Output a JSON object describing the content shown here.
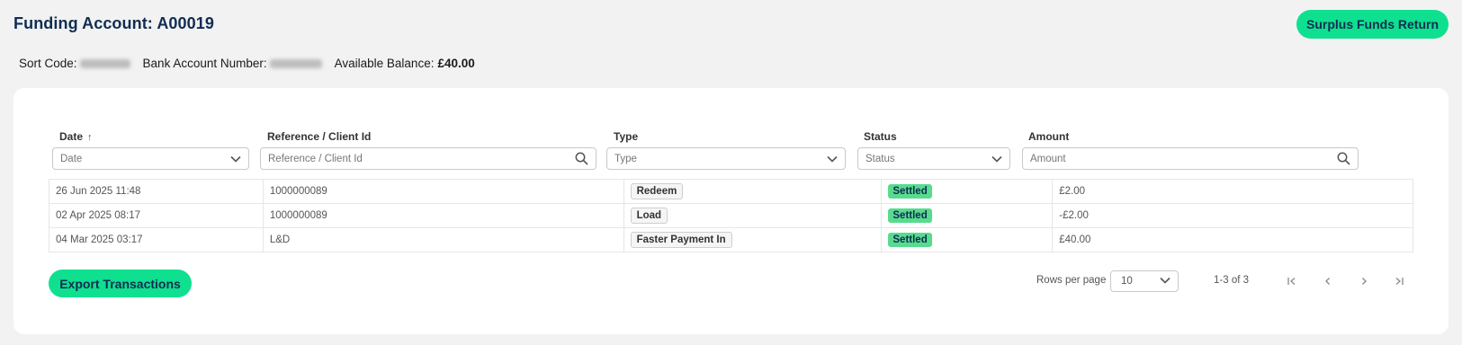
{
  "header": {
    "title": "Funding Account: A00019",
    "surplus_button": "Surplus Funds Return"
  },
  "account": {
    "sort_code_label": "Sort Code:",
    "bank_account_label": "Bank Account Number:",
    "balance_label": "Available Balance:",
    "balance_value": "£40.00"
  },
  "table": {
    "columns": [
      {
        "label": "Date",
        "filter_placeholder": "Date",
        "filter_type": "select"
      },
      {
        "label": "Reference / Client Id",
        "filter_placeholder": "Reference / Client Id",
        "filter_type": "search"
      },
      {
        "label": "Type",
        "filter_placeholder": "Type",
        "filter_type": "select"
      },
      {
        "label": "Status",
        "filter_placeholder": "Status",
        "filter_type": "select"
      },
      {
        "label": "Amount",
        "filter_placeholder": "Amount",
        "filter_type": "search"
      }
    ],
    "rows": [
      {
        "date": "26 Jun 2025 11:48",
        "reference": "1000000089",
        "type": "Redeem",
        "status": "Settled",
        "amount": "£2.00"
      },
      {
        "date": "02 Apr 2025 08:17",
        "reference": "1000000089",
        "type": "Load",
        "status": "Settled",
        "amount": "-£2.00"
      },
      {
        "date": "04 Mar 2025 03:17",
        "reference": "L&D",
        "type": "Faster Payment In",
        "status": "Settled",
        "amount": "£40.00"
      }
    ]
  },
  "footer": {
    "export_button": "Export Transactions",
    "rows_per_page_label": "Rows per page",
    "rows_per_page_value": "10",
    "range": "1-3 of 3"
  },
  "icons": {
    "sort": "arrow-up-icon",
    "select": "chevron-down-icon",
    "search": "search-icon",
    "pager": [
      "first-page-icon",
      "previous-page-icon",
      "next-page-icon",
      "last-page-icon"
    ]
  },
  "colors": {
    "accent": "#0fe08f",
    "title": "#0f2d52",
    "status_settled": "#58db8f"
  }
}
